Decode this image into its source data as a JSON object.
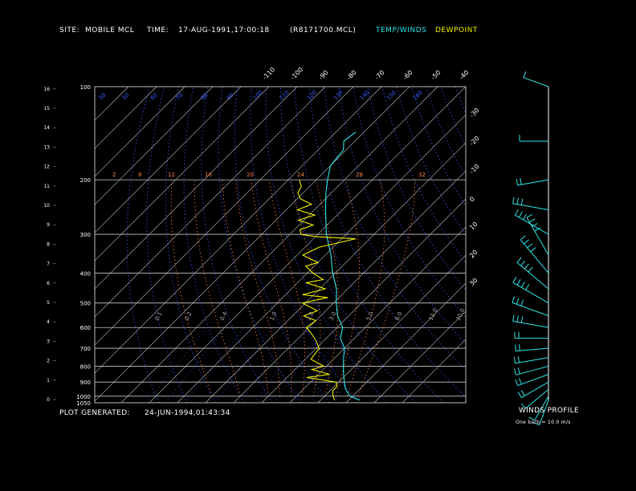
{
  "header": {
    "site_label": "SITE:",
    "site_value": "MOBILE MCL",
    "time_label": "TIME:",
    "time_value": "17-AUG-1991,17:00:18",
    "file": "(R8171700.MCL)",
    "temp_winds": "TEMP/WINDS",
    "dewpoint": "DEWPOINT"
  },
  "footer": {
    "plot_generated_label": "PLOT GENERATED:",
    "plot_generated_value": "24-JUN-1994,01:43:34",
    "winds_profile": "WINDS PROFILE",
    "barb_note": "One barb = 10.0 m/s"
  },
  "colors": {
    "temperature": "#2ee6e6",
    "dewpoint": "#f0f000",
    "isobar": "#c8c8c8",
    "isotherm": "#c8c8c8",
    "dry_adiabat": "#3a5cff",
    "moist_adiabat": "#ff8040",
    "mixing_ratio": "#3a5cff",
    "wind": "#2ee6e6"
  },
  "chart_data": {
    "type": "line",
    "title": "",
    "pressure_levels": [
      100,
      200,
      300,
      400,
      500,
      600,
      700,
      800,
      900,
      1000,
      1050
    ],
    "height_ticks_km": [
      0,
      1,
      2,
      3,
      4,
      5,
      6,
      7,
      8,
      9,
      10,
      11,
      12,
      13,
      14,
      15,
      16
    ],
    "isotherm_top_labels": [
      "-110",
      "-100",
      "-90",
      "-80",
      "-70",
      "-60",
      "-50",
      "-40"
    ],
    "isotherm_right_labels": [
      "-30",
      "-20",
      "-10",
      "0",
      "10",
      "20",
      "30"
    ],
    "dry_adiabat_labels": [
      "50",
      "50",
      "60",
      "70",
      "80",
      "90",
      "100",
      "110",
      "120",
      "130",
      "140",
      "150",
      "160"
    ],
    "moist_adiabat_labels": [
      "2",
      "8",
      "12",
      "16",
      "20",
      "24",
      "28",
      "32"
    ],
    "mixing_ratio_labels": [
      "0.1",
      "0.2",
      "0.4",
      "1.0",
      "2.0",
      "3.0",
      "5.0",
      "8.0",
      "12.0",
      "20.0"
    ],
    "series": [
      {
        "name": "TEMP/WINDS",
        "pressure": [
          1030,
          1000,
          950,
          900,
          850,
          800,
          750,
          700,
          650,
          600,
          550,
          500,
          450,
          400,
          350,
          300,
          250,
          220,
          200,
          180,
          160,
          150,
          140
        ],
        "temperature": [
          34,
          29,
          25,
          22,
          19,
          16,
          13,
          10,
          5,
          2,
          -4,
          -9,
          -14,
          -21,
          -28,
          -37,
          -46,
          -52,
          -56,
          -60,
          -61,
          -64,
          -63
        ]
      },
      {
        "name": "DEWPOINT",
        "pressure": [
          1030,
          1000,
          960,
          930,
          900,
          870,
          850,
          820,
          800,
          760,
          700,
          660,
          620,
          600,
          570,
          550,
          530,
          500,
          480,
          470,
          450,
          430,
          420,
          400,
          380,
          370,
          350,
          330,
          320,
          310,
          305,
          300,
          290,
          280,
          270,
          260,
          250,
          240,
          230,
          220,
          210,
          200
        ],
        "dewpoint": [
          25,
          23,
          21,
          21,
          19,
          7,
          14,
          6,
          9,
          2,
          1,
          -3,
          -8,
          -11,
          -10,
          -16,
          -13,
          -21,
          -14,
          -24,
          -18,
          -27,
          -22,
          -28,
          -33,
          -30,
          -38,
          -35,
          -30,
          -25,
          -40,
          -46,
          -48,
          -45,
          -52,
          -48,
          -56,
          -53,
          -59,
          -62,
          -63,
          -66
        ]
      }
    ],
    "winds_profile": {
      "pressure": [
        1030,
        1000,
        950,
        900,
        850,
        800,
        750,
        700,
        650,
        600,
        550,
        500,
        450,
        400,
        350,
        300,
        250,
        200,
        150,
        100
      ],
      "direction_deg": [
        200,
        210,
        230,
        240,
        250,
        255,
        260,
        265,
        270,
        280,
        290,
        300,
        310,
        320,
        330,
        300,
        280,
        260,
        270,
        290
      ],
      "speed_ms": [
        5,
        8,
        12,
        15,
        18,
        20,
        20,
        18,
        20,
        25,
        30,
        35,
        35,
        40,
        40,
        30,
        25,
        15,
        10,
        5
      ]
    }
  }
}
